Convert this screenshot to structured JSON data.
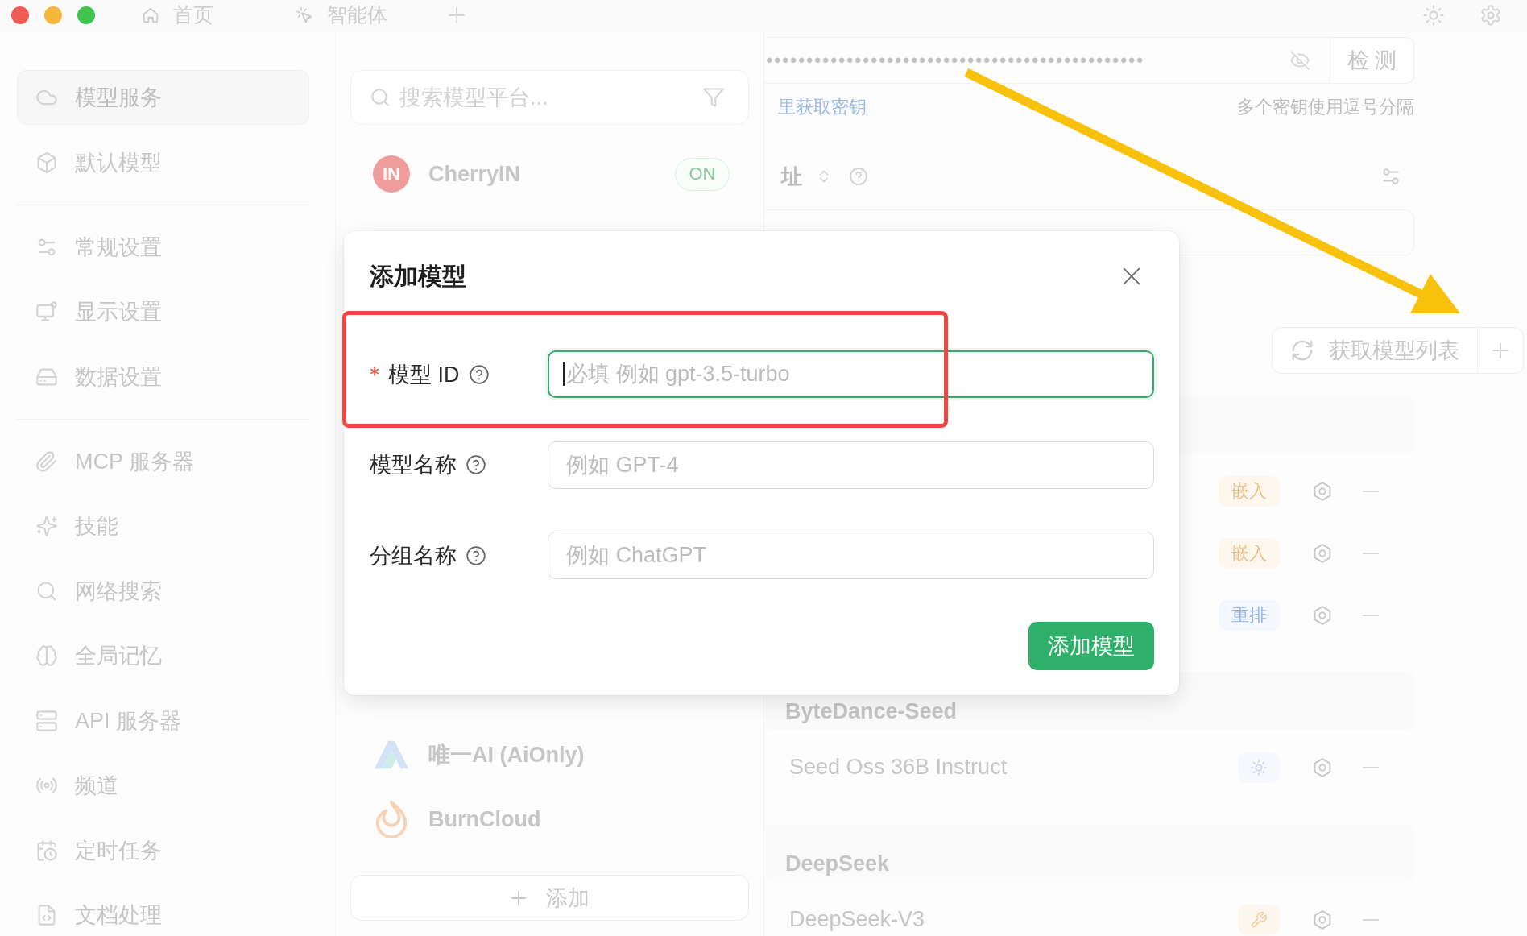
{
  "tabs": [
    {
      "label": "首页",
      "selected": false
    },
    {
      "label": "智能体",
      "selected": false
    }
  ],
  "sidebar": {
    "groups": [
      {
        "items": [
          {
            "label": "模型服务",
            "selected": true
          },
          {
            "label": "默认模型",
            "selected": false
          }
        ]
      },
      {
        "items": [
          {
            "label": "常规设置",
            "selected": false
          },
          {
            "label": "显示设置",
            "selected": false
          },
          {
            "label": "数据设置",
            "selected": false
          }
        ]
      },
      {
        "items": [
          {
            "label": "MCP 服务器",
            "selected": false
          },
          {
            "label": "技能",
            "selected": false
          },
          {
            "label": "网络搜索",
            "selected": false
          },
          {
            "label": "全局记忆",
            "selected": false
          },
          {
            "label": "API 服务器",
            "selected": false
          },
          {
            "label": "频道",
            "selected": false
          },
          {
            "label": "定时任务",
            "selected": false
          },
          {
            "label": "文档处理",
            "selected": false
          }
        ]
      }
    ]
  },
  "providers": {
    "search": {
      "placeholder": "搜索模型平台..."
    },
    "items": [
      {
        "name": "CherryIN",
        "logo_text": "IN",
        "badge": "ON"
      },
      {
        "name": "唯一AI (AiOnly)"
      },
      {
        "name": "BurnCloud"
      }
    ],
    "add_button": "添加"
  },
  "provider_settings": {
    "api_key": {
      "value": "•••••••••••••••••••••••••••••••••••••••••••••••",
      "check_button": "检 测",
      "link": "里获取密钥",
      "hint": "多个密钥使用逗号分隔"
    },
    "api_host": {
      "label": "址"
    },
    "fetch_button": "获取模型列表",
    "model_groups": [
      {
        "models": [
          {
            "capabilities": [
              {
                "kind": "embedding",
                "label": "嵌入"
              }
            ]
          },
          {
            "capabilities": [
              {
                "kind": "embedding",
                "label": "嵌入"
              }
            ]
          },
          {
            "capabilities": [
              {
                "kind": "rerank",
                "label": "重排"
              }
            ]
          }
        ]
      },
      {
        "name": "ByteDance-Seed",
        "models": [
          {
            "name": "Seed Oss 36B Instruct",
            "capabilities": [
              {
                "kind": "reasoning"
              }
            ]
          }
        ]
      },
      {
        "name": "DeepSeek",
        "models": [
          {
            "name": "DeepSeek-V3",
            "capabilities": [
              {
                "kind": "tool"
              }
            ]
          }
        ]
      }
    ]
  },
  "dialog": {
    "title": "添加模型",
    "fields": [
      {
        "label": "模型 ID",
        "required": true,
        "focused": true,
        "highlighted": true,
        "placeholder": "必填 例如 gpt-3.5-turbo"
      },
      {
        "label": "模型名称",
        "required": false,
        "focused": false,
        "highlighted": false,
        "placeholder": "例如 GPT-4"
      },
      {
        "label": "分组名称",
        "required": false,
        "focused": false,
        "highlighted": false,
        "placeholder": "例如 ChatGPT"
      }
    ],
    "submit_button": "添加模型"
  }
}
